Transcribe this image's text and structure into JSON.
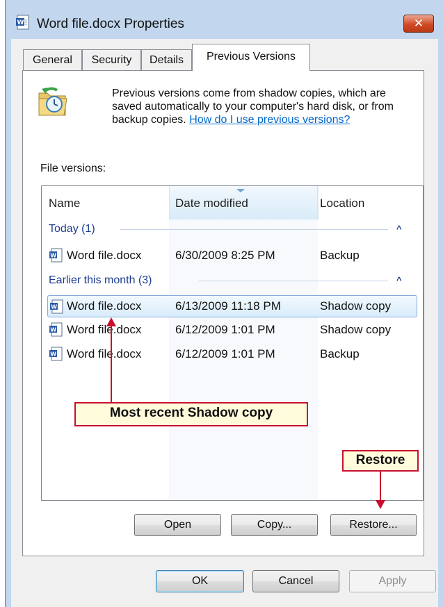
{
  "window": {
    "title": "Word file.docx Properties",
    "close_glyph": "✕"
  },
  "tabs": [
    {
      "label": "General"
    },
    {
      "label": "Security"
    },
    {
      "label": "Details"
    },
    {
      "label": "Previous Versions"
    }
  ],
  "info": {
    "text": "Previous versions come from shadow copies, which are saved automatically to your computer's hard disk, or from backup copies. ",
    "link": "How do I use previous versions?"
  },
  "file_versions_label": "File versions:",
  "columns": [
    "Name",
    "Date modified",
    "Location"
  ],
  "groups": [
    {
      "label": "Today (1)"
    },
    {
      "label": "Earlier this month (3)"
    }
  ],
  "rows": [
    {
      "name": "Word file.docx",
      "date": "6/30/2009 8:25 PM",
      "location": "Backup"
    },
    {
      "name": "Word file.docx",
      "date": "6/13/2009 11:18 PM",
      "location": "Shadow copy"
    },
    {
      "name": "Word file.docx",
      "date": "6/12/2009 1:01 PM",
      "location": "Shadow copy"
    },
    {
      "name": "Word file.docx",
      "date": "6/12/2009 1:01 PM",
      "location": "Backup"
    }
  ],
  "buttons": {
    "open": "Open",
    "copy": "Copy...",
    "restore": "Restore...",
    "ok": "OK",
    "cancel": "Cancel",
    "apply": "Apply"
  },
  "callouts": {
    "shadow": "Most recent Shadow copy",
    "restore": "Restore"
  },
  "colors": {
    "callout_border": "#c8102e",
    "callout_fill": "#fffbdb",
    "link": "#0066cc",
    "group_text": "#1e3d8f"
  },
  "icons": [
    "word-document-icon",
    "folder-clock-icon",
    "close-icon",
    "chevron-up-icon",
    "sort-indicator-icon"
  ]
}
